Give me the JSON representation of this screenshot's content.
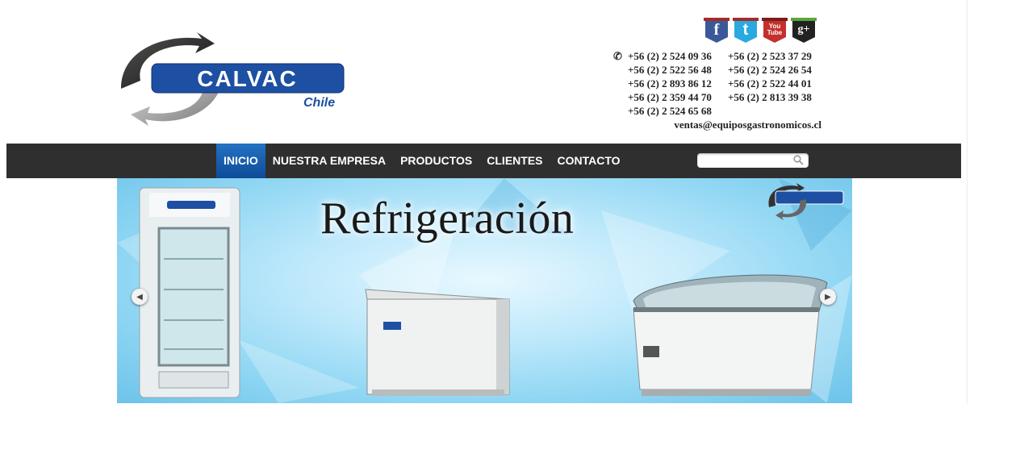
{
  "logo": {
    "word": "CALVAC",
    "sub": "Chile"
  },
  "social": [
    {
      "name": "facebook",
      "glyph": "f",
      "color": "#3b5998"
    },
    {
      "name": "twitter",
      "glyph": "t",
      "color": "#2aa9e0"
    },
    {
      "name": "youtube",
      "glyph": "You Tube",
      "color": "#c4302b"
    },
    {
      "name": "google-plus",
      "glyph": "g+",
      "color": "#222222"
    }
  ],
  "contact": {
    "phones": [
      "+56 (2) 2 524 09 36",
      "+56 (2) 2 523 37 29",
      "+56 (2) 2 522 56 48",
      "+56 (2) 2 524 26 54",
      "+56 (2) 2 893 86 12",
      "+56 (2) 2 522 44 01",
      "+56 (2) 2 359 44 70",
      "+56 (2) 2 813 39 38",
      "+56 (2) 2 524 65 68"
    ],
    "email": "ventas@equiposgastronomicos.cl"
  },
  "nav": {
    "items": [
      "INICIO",
      "NUESTRA EMPRESA",
      "PRODUCTOS",
      "CLIENTES",
      "CONTACTO"
    ],
    "active": "INICIO"
  },
  "search": {
    "placeholder": ""
  },
  "banner": {
    "title": "Refrigeración"
  },
  "colors": {
    "brand_blue": "#1d4fa3",
    "nav_bg": "#2f2f2f",
    "nav_active": "#1d6fc0"
  }
}
